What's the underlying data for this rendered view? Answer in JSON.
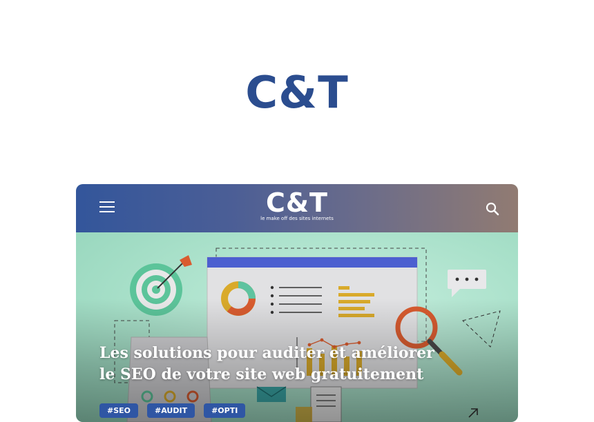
{
  "site": {
    "logo_text": "C&T"
  },
  "card": {
    "header": {
      "logo_text": "C&T",
      "tagline": "le make off des sites internets"
    },
    "article": {
      "title": "Les solutions pour auditer et améliorer le SEO de votre site web gratuitement",
      "tags": [
        "#SEO",
        "#AUDIT",
        "#OPTI"
      ]
    }
  },
  "icons": [
    "menu-icon",
    "search-icon",
    "expand-arrow-icon",
    "seo-audit-illustration"
  ],
  "colors": {
    "brand_blue": "#2b4d8f",
    "header_gradient_start": "#33569b",
    "header_gradient_end": "#917b72",
    "hero_background": "#a4ddc6",
    "tag_background": "#2f56a4"
  }
}
